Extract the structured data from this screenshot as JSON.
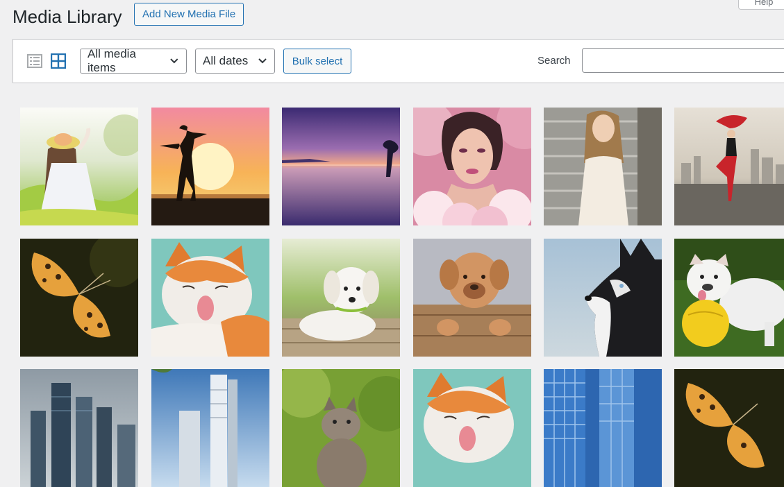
{
  "header": {
    "title": "Media Library",
    "add_new_label": "Add New Media File",
    "help_label": "Help"
  },
  "toolbar": {
    "view_list_icon": "list-view-icon",
    "view_grid_icon": "grid-view-icon",
    "media_type_filter": "All media items",
    "date_filter": "All dates",
    "bulk_select_label": "Bulk select",
    "search_label": "Search",
    "search_value": ""
  },
  "colors": {
    "accent": "#2271b1",
    "background": "#f0f0f1",
    "border": "#c3c4c7"
  },
  "media_items": [
    {
      "subject": "girl-with-straw-hat-in-meadow"
    },
    {
      "subject": "silhouette-at-sunset"
    },
    {
      "subject": "purple-sea-sunset"
    },
    {
      "subject": "woman-portrait-pink-smoke"
    },
    {
      "subject": "woman-on-stone-steps"
    },
    {
      "subject": "dancer-with-red-scarf-city"
    },
    {
      "subject": "orange-butterfly"
    },
    {
      "subject": "orange-cat-licking"
    },
    {
      "subject": "white-puppy-on-wood"
    },
    {
      "subject": "brown-puppy-on-fence"
    },
    {
      "subject": "husky-profile"
    },
    {
      "subject": "bulldog-with-yellow-ball"
    },
    {
      "subject": "city-skyscrapers-cloudy"
    },
    {
      "subject": "glass-towers-blue-sky"
    },
    {
      "subject": "kitten-in-grass"
    },
    {
      "subject": "orange-cat-licking"
    },
    {
      "subject": "blue-glass-buildings"
    },
    {
      "subject": "orange-butterfly"
    }
  ]
}
